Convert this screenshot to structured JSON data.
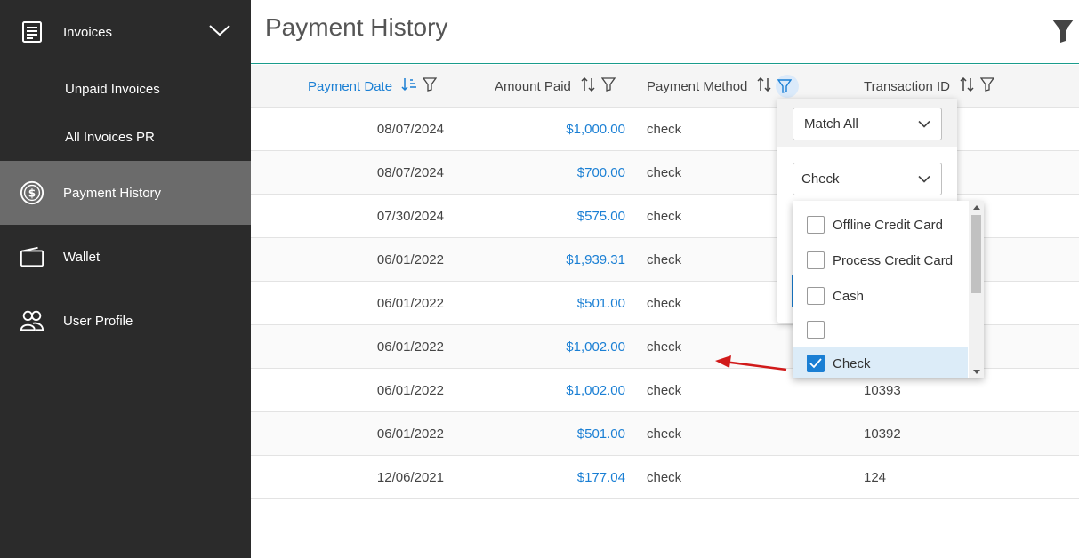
{
  "sidebar": {
    "items": [
      {
        "label": "Invoices",
        "icon": "invoice-icon"
      },
      {
        "label": "Unpaid Invoices"
      },
      {
        "label": "All Invoices PR"
      },
      {
        "label": "Payment History",
        "icon": "dollar-icon"
      },
      {
        "label": "Wallet",
        "icon": "wallet-icon"
      },
      {
        "label": "User Profile",
        "icon": "users-icon"
      }
    ]
  },
  "header": {
    "title": "Payment History"
  },
  "table": {
    "columns": [
      "Payment Date",
      "Amount Paid",
      "Payment Method",
      "Transaction ID"
    ],
    "rows": [
      {
        "date": "08/07/2024",
        "amount": "$1,000.00",
        "method": "check",
        "tid": ""
      },
      {
        "date": "08/07/2024",
        "amount": "$700.00",
        "method": "check",
        "tid": ""
      },
      {
        "date": "07/30/2024",
        "amount": "$575.00",
        "method": "check",
        "tid": ""
      },
      {
        "date": "06/01/2022",
        "amount": "$1,939.31",
        "method": "check",
        "tid": ""
      },
      {
        "date": "06/01/2022",
        "amount": "$501.00",
        "method": "check",
        "tid": ""
      },
      {
        "date": "06/01/2022",
        "amount": "$1,002.00",
        "method": "check",
        "tid": ""
      },
      {
        "date": "06/01/2022",
        "amount": "$1,002.00",
        "method": "check",
        "tid": "10393"
      },
      {
        "date": "06/01/2022",
        "amount": "$501.00",
        "method": "check",
        "tid": "10392"
      },
      {
        "date": "12/06/2021",
        "amount": "$177.04",
        "method": "check",
        "tid": "124"
      }
    ]
  },
  "filter_popup": {
    "match_mode": "Match All",
    "value": "Check",
    "options": [
      {
        "label": "Offline Credit Card",
        "checked": false
      },
      {
        "label": "Process Credit Card",
        "checked": false
      },
      {
        "label": "Cash",
        "checked": false
      },
      {
        "label": "",
        "checked": false
      },
      {
        "label": "Check",
        "checked": true
      }
    ]
  },
  "colors": {
    "accent": "#1a7fd4",
    "sidebar_bg": "#2b2b2b",
    "sidebar_active": "#6b6b6b",
    "header_rule": "#1a9c8c",
    "arrow": "#d11a1a"
  }
}
